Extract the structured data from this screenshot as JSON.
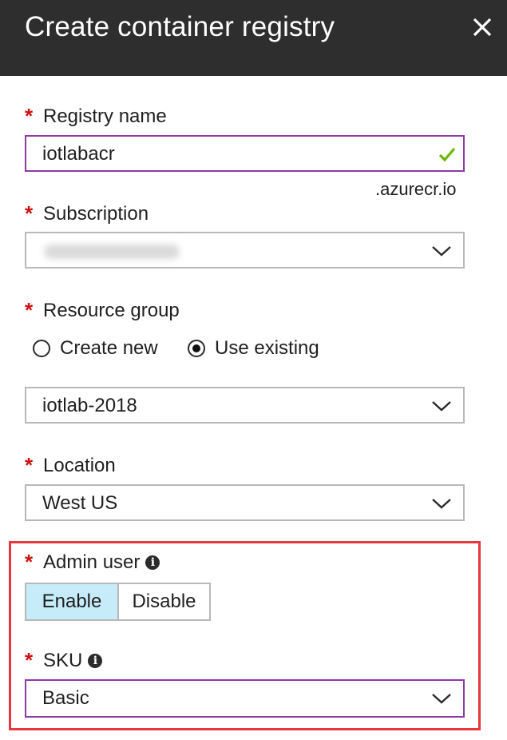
{
  "header": {
    "title": "Create container registry"
  },
  "registry_name": {
    "label": "Registry name",
    "value": "iotlabacr",
    "suffix": ".azurecr.io"
  },
  "subscription": {
    "label": "Subscription",
    "value": ""
  },
  "resource_group": {
    "label": "Resource group",
    "options": [
      "Create new",
      "Use existing"
    ],
    "selected": "Use existing",
    "value": "iotlab-2018"
  },
  "location": {
    "label": "Location",
    "value": "West US"
  },
  "admin_user": {
    "label": "Admin user",
    "options": [
      "Enable",
      "Disable"
    ],
    "selected": "Enable"
  },
  "sku": {
    "label": "SKU",
    "value": "Basic"
  },
  "colors": {
    "required": "#d01010",
    "focus_border": "#8c3aa5",
    "highlight": "#e8383d",
    "toggle_on": "#c6ecf9"
  }
}
